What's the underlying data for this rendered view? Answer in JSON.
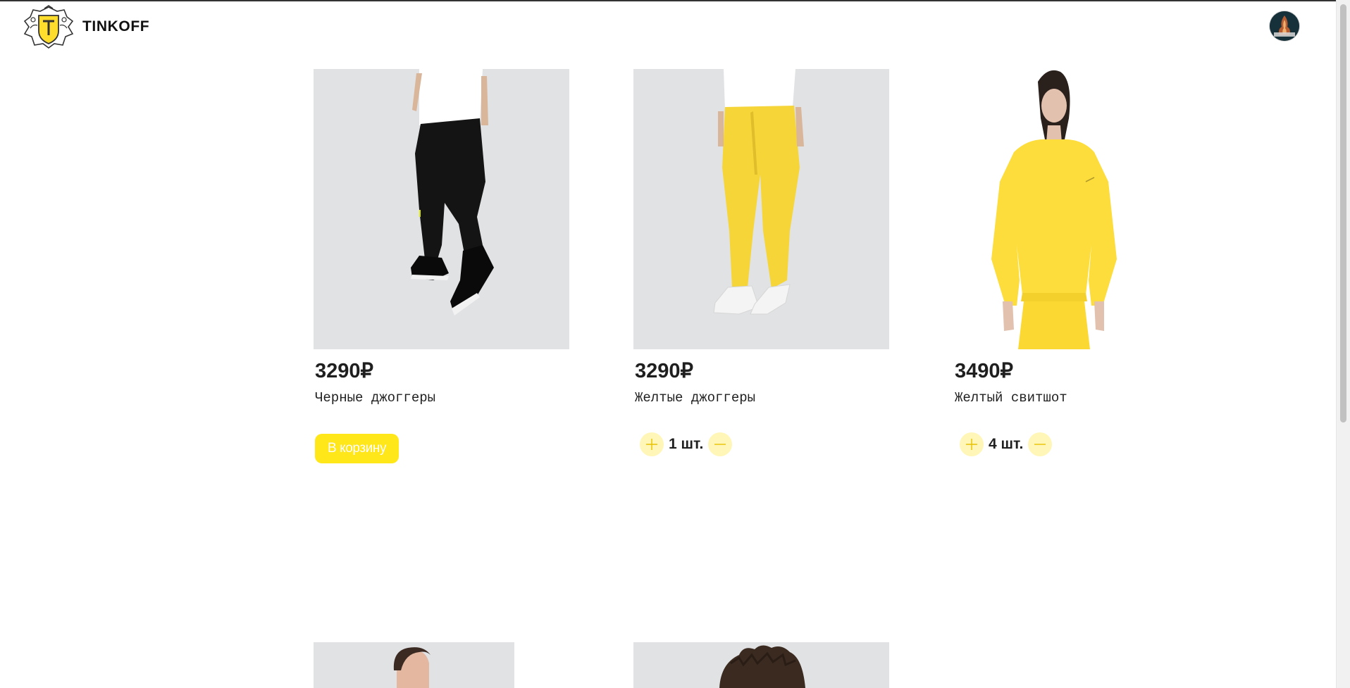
{
  "header": {
    "brand": "TINKOFF"
  },
  "products": [
    {
      "price": "3290₽",
      "title": "Черные джоггеры",
      "action": "cart",
      "cart_label": "В корзину"
    },
    {
      "price": "3290₽",
      "title": "Желтые джоггеры",
      "action": "quantity",
      "quantity": "1 шт."
    },
    {
      "price": "3490₽",
      "title": "Желтый свитшот",
      "action": "quantity",
      "quantity": "4 шт."
    }
  ],
  "colors": {
    "accent": "#ffe71a",
    "qty_button": "#fff6b8",
    "image_bg": "#e1e2e4",
    "text": "#1f1f1f"
  }
}
